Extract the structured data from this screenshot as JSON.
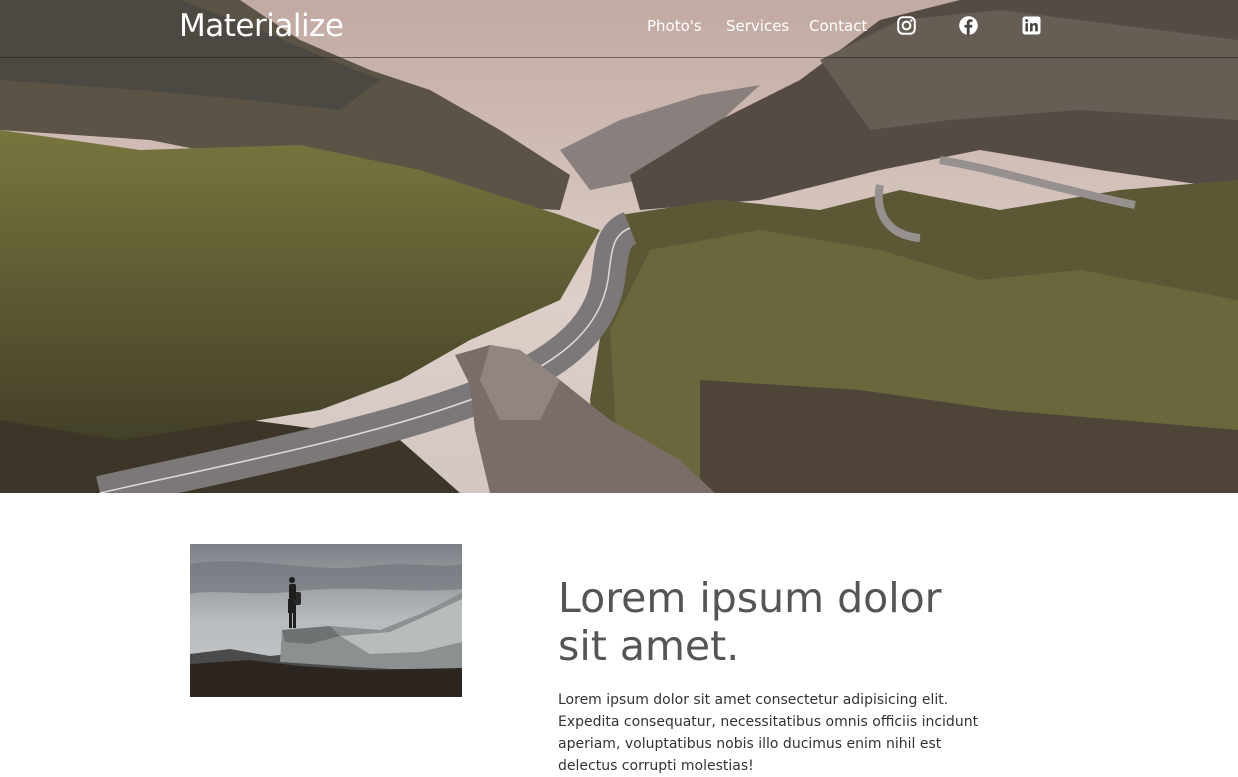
{
  "navbar": {
    "brand": "Materialize",
    "links": [
      "Photo's",
      "Services",
      "Contact"
    ],
    "icons": [
      "instagram-icon",
      "facebook-icon",
      "linkedin-icon"
    ]
  },
  "hero": {
    "image": "mountain-road-valley"
  },
  "content": {
    "image": "hiker-on-rock",
    "heading": "Lorem ipsum dolor sit amet.",
    "body": "Lorem ipsum dolor sit amet consectetur adipisicing elit. Expedita consequatur, necessitatibus omnis officiis incidunt aperiam, voluptatibus nobis illo ducimus enim nihil est delectus corrupti molestias!"
  }
}
